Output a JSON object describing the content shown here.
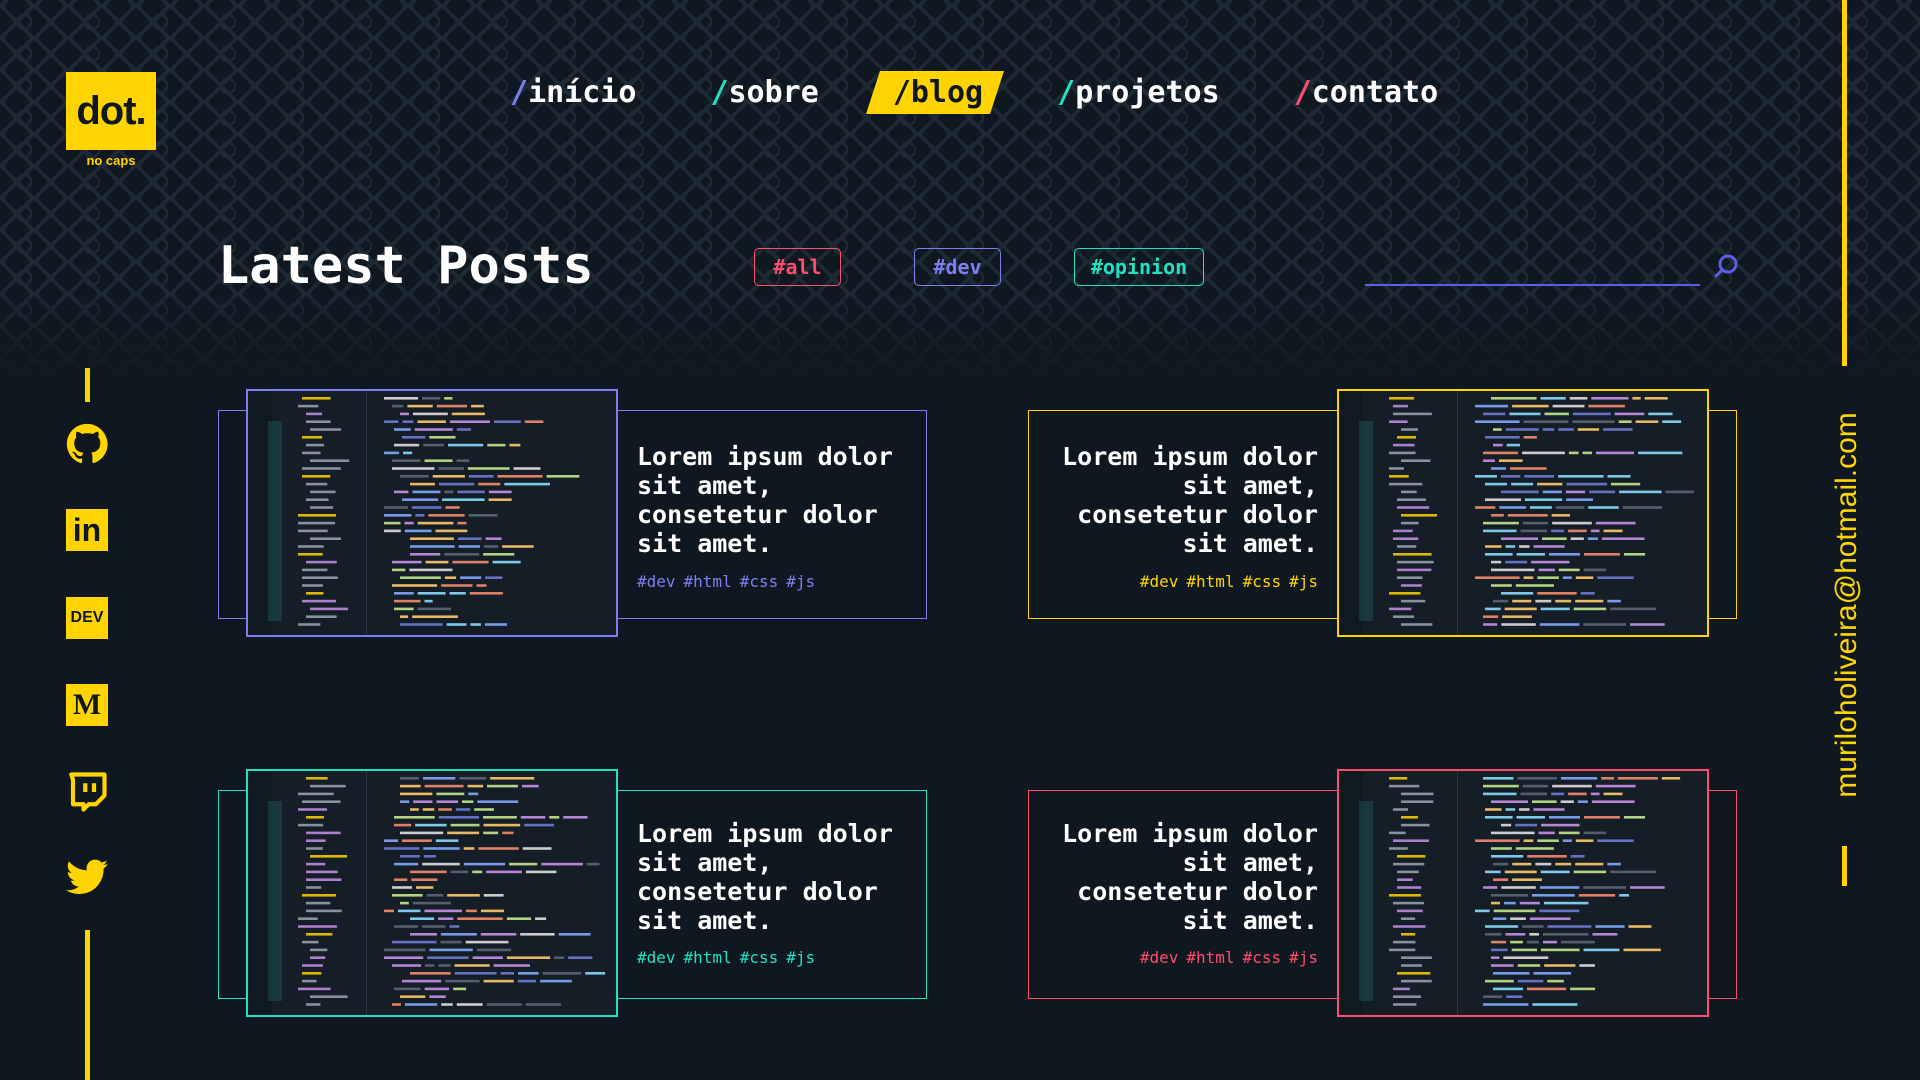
{
  "logo": {
    "text": "dot.",
    "subtitle": "no caps"
  },
  "nav": [
    {
      "slash": "/",
      "label": "início",
      "color": "#7d7ff0",
      "active": false
    },
    {
      "slash": "/",
      "label": "sobre",
      "color": "#22e0c0",
      "active": false
    },
    {
      "slash": "/",
      "label": "blog",
      "color": "#0f1820",
      "active": true
    },
    {
      "slash": "/",
      "label": "projetos",
      "color": "#22e0c0",
      "active": false
    },
    {
      "slash": "/",
      "label": "contato",
      "color": "#ff4d6d",
      "active": false
    }
  ],
  "page_title": "Latest Posts",
  "filters": [
    {
      "label": "#all",
      "color": "#ff4d6d"
    },
    {
      "label": "#dev",
      "color": "#7d7ff0"
    },
    {
      "label": "#opinion",
      "color": "#22e0c0"
    }
  ],
  "search": {
    "placeholder": "",
    "icon": "search-icon"
  },
  "email": "muriloholiveira@hotmail.com",
  "socials": [
    {
      "name": "github-icon"
    },
    {
      "name": "linkedin-icon",
      "text": "in"
    },
    {
      "name": "dev-icon",
      "text": "DEV"
    },
    {
      "name": "medium-icon",
      "text": "M"
    },
    {
      "name": "twitch-icon"
    },
    {
      "name": "twitter-icon"
    }
  ],
  "posts": [
    {
      "title": "Lorem ipsum dolor sit amet, consetetur dolor sit amet.",
      "tags": [
        "#dev",
        "#html",
        "#css",
        "#js"
      ],
      "accent": "#7d7ff0",
      "align": "left"
    },
    {
      "title": "Lorem ipsum dolor sit amet, consetetur dolor sit amet.",
      "tags": [
        "#dev",
        "#html",
        "#css",
        "#js"
      ],
      "accent": "#ffd400",
      "align": "right"
    },
    {
      "title": "Lorem ipsum dolor sit amet, consetetur dolor sit amet.",
      "tags": [
        "#dev",
        "#html",
        "#css",
        "#js"
      ],
      "accent": "#22e0c0",
      "align": "left"
    },
    {
      "title": "Lorem ipsum dolor sit amet, consetetur dolor sit amet.",
      "tags": [
        "#dev",
        "#html",
        "#css",
        "#js"
      ],
      "accent": "#ff4d6d",
      "align": "right"
    }
  ],
  "colors": {
    "background": "#0f1820",
    "brand": "#ffd400",
    "text": "#ffffff"
  }
}
